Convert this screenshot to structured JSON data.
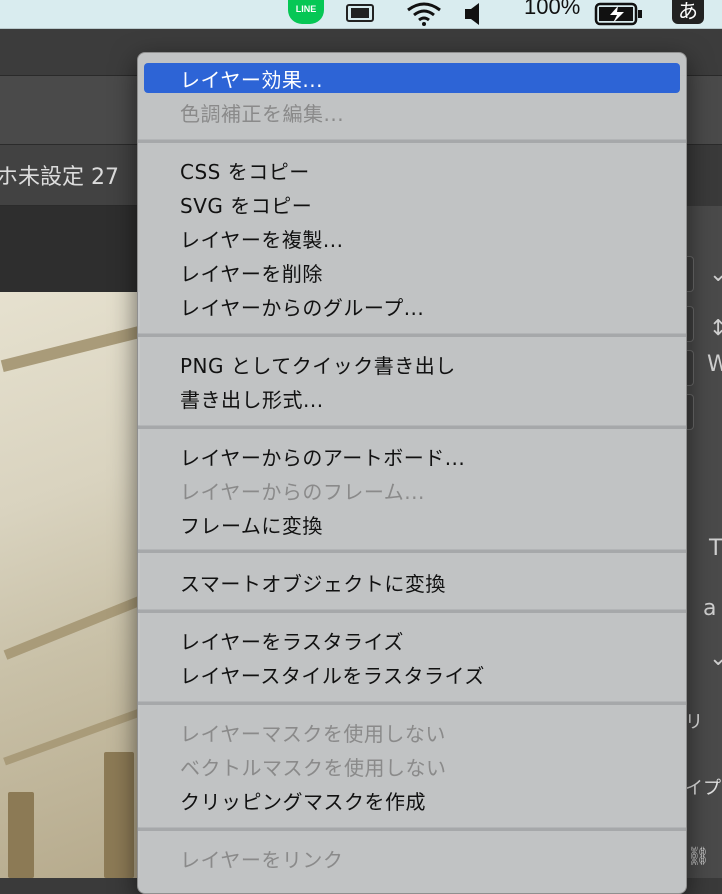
{
  "menubar": {
    "line_label": "LINE",
    "battery_percent": "100%",
    "ime_indicator": "あ"
  },
  "document": {
    "tab_title": "ホ未設定 27"
  },
  "right_panel": {
    "label_ri": "リ",
    "label_ipu": "イプ"
  },
  "context_menu": {
    "items": [
      {
        "label": "レイヤー効果...",
        "state": "highlighted"
      },
      {
        "label": "色調補正を編集...",
        "state": "disabled"
      },
      {
        "label": "CSS をコピー",
        "state": "enabled"
      },
      {
        "label": "SVG をコピー",
        "state": "enabled"
      },
      {
        "label": "レイヤーを複製...",
        "state": "enabled"
      },
      {
        "label": "レイヤーを削除",
        "state": "enabled"
      },
      {
        "label": "レイヤーからのグループ...",
        "state": "enabled"
      },
      {
        "label": "PNG としてクイック書き出し",
        "state": "enabled"
      },
      {
        "label": "書き出し形式...",
        "state": "enabled"
      },
      {
        "label": "レイヤーからのアートボード...",
        "state": "enabled"
      },
      {
        "label": "レイヤーからのフレーム...",
        "state": "disabled"
      },
      {
        "label": "フレームに変換",
        "state": "enabled"
      },
      {
        "label": "スマートオブジェクトに変換",
        "state": "enabled"
      },
      {
        "label": "レイヤーをラスタライズ",
        "state": "enabled"
      },
      {
        "label": "レイヤースタイルをラスタライズ",
        "state": "enabled"
      },
      {
        "label": "レイヤーマスクを使用しない",
        "state": "disabled"
      },
      {
        "label": "ベクトルマスクを使用しない",
        "state": "disabled"
      },
      {
        "label": "クリッピングマスクを作成",
        "state": "enabled"
      },
      {
        "label": "レイヤーをリンク",
        "state": "disabled"
      }
    ]
  }
}
